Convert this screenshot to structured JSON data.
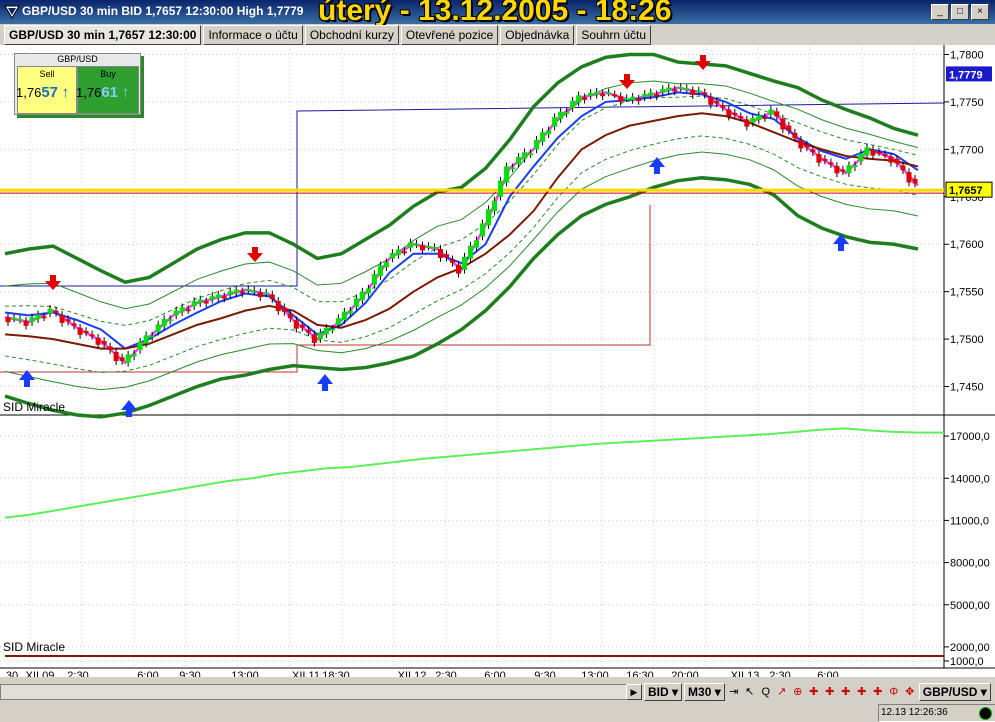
{
  "window": {
    "title": "GBP/USD 30 min BID 1,7657 12:30:00 High 1,7779",
    "date_overlay": "úterý - 13.12.2005 - 18:26",
    "minimize": "_",
    "restore": "□",
    "close": "×"
  },
  "tabs": [
    {
      "label": "GBP/USD 30 min 1,7657 12:30:00",
      "active": true
    },
    {
      "label": "Informace o účtu"
    },
    {
      "label": "Obchodní kurzy"
    },
    {
      "label": "Otevřené pozice"
    },
    {
      "label": "Objednávka"
    },
    {
      "label": "Souhrn účtu"
    }
  ],
  "quote_widget": {
    "symbol": "GBP/USD",
    "sell": {
      "label": "Sell",
      "price_prefix": "1,76",
      "price_pips": "57",
      "arrow": "↑"
    },
    "buy": {
      "label": "Buy",
      "price_prefix": "1,76",
      "price_pips": "61",
      "arrow": "↑"
    }
  },
  "price_panel": {
    "indicator_label": "SID Miracle",
    "y_ticks": [
      "1,7800",
      "1,7750",
      "1,7700",
      "1,7650",
      "1,7600",
      "1,7550",
      "1,7500",
      "1,7450"
    ],
    "current_price": "1,7657",
    "high_price": "1,7779",
    "colors": {
      "bull": "#00e000",
      "bear": "#e00000",
      "upper_band": "#1e7e1e",
      "price_line": "#ffd700",
      "arrow_up": "#1a3cff",
      "arrow_down": "#e00000",
      "magenta": "#ff40ff",
      "blue_ma": "#1a3cff",
      "brown_ma": "#7a1a00"
    }
  },
  "volume_panel": {
    "indicator_label": "SID Miracle",
    "y_ticks": [
      "17000,0",
      "14000,0",
      "11000,0",
      "8000,00",
      "5000,00",
      "2000,00",
      "1000,0"
    ]
  },
  "x_axis": {
    "ticks": [
      "30",
      "XII.09",
      "2:30",
      "6:00",
      "9:30",
      "13:00",
      "XII.11",
      "18:30",
      "XII.12",
      "2:30",
      "6:00",
      "9:30",
      "13:00",
      "16:30",
      "20:00",
      "XII.13",
      "2:30",
      "6:00"
    ]
  },
  "chart_data": [
    {
      "type": "line",
      "title": "",
      "ylabel": "",
      "ylim": [
        1.742,
        1.781
      ],
      "series": [
        {
          "values": [
            1.7523,
            1.7518,
            1.753,
            1.7512,
            1.7498,
            1.7475,
            1.7502,
            1.7525,
            1.7538,
            1.7545,
            1.7552,
            1.7547,
            1.752,
            1.75,
            1.752,
            1.7548,
            1.7585,
            1.76,
            1.7595,
            1.7573,
            1.762,
            1.768,
            1.77,
            1.7732,
            1.7755,
            1.776,
            1.7752,
            1.7758,
            1.7765,
            1.776,
            1.7742,
            1.7728,
            1.774,
            1.771,
            1.769,
            1.7675,
            1.77,
            1.769,
            1.7662
          ]
        },
        {
          "values": [
            1.7528,
            1.7525,
            1.7528,
            1.752,
            1.751,
            1.749,
            1.75,
            1.7515,
            1.7528,
            1.754,
            1.7548,
            1.7545,
            1.7525,
            1.7505,
            1.7515,
            1.7538,
            1.757,
            1.759,
            1.759,
            1.758,
            1.76,
            1.765,
            1.7682,
            1.7712,
            1.7735,
            1.775,
            1.7752,
            1.7755,
            1.776,
            1.7758,
            1.775,
            1.7738,
            1.7732,
            1.7712,
            1.7698,
            1.769,
            1.77,
            1.7695,
            1.7678
          ]
        },
        {
          "values": [
            1.7505,
            1.7503,
            1.75,
            1.7495,
            1.749,
            1.749,
            1.7495,
            1.7505,
            1.7515,
            1.7522,
            1.753,
            1.7535,
            1.753,
            1.7515,
            1.7512,
            1.752,
            1.7532,
            1.755,
            1.7565,
            1.7575,
            1.759,
            1.761,
            1.7635,
            1.767,
            1.77,
            1.7715,
            1.7725,
            1.773,
            1.7735,
            1.7738,
            1.7735,
            1.7728,
            1.7718,
            1.7708,
            1.77,
            1.7693,
            1.769,
            1.7688,
            1.7682
          ]
        },
        {
          "values": [
            1.759,
            1.7595,
            1.7598,
            1.7585,
            1.7572,
            1.756,
            1.7565,
            1.758,
            1.7595,
            1.7605,
            1.7612,
            1.7612,
            1.76,
            1.7585,
            1.759,
            1.7605,
            1.762,
            1.764,
            1.7655,
            1.766,
            1.768,
            1.771,
            1.7745,
            1.777,
            1.7787,
            1.7797,
            1.78,
            1.78,
            1.7792,
            1.779,
            1.7788,
            1.778,
            1.7772,
            1.7765,
            1.7752,
            1.7742,
            1.7733,
            1.7722,
            1.7715
          ]
        },
        {
          "values": [
            1.744,
            1.7432,
            1.7425,
            1.742,
            1.7418,
            1.7422,
            1.743,
            1.744,
            1.745,
            1.7458,
            1.7462,
            1.7468,
            1.7472,
            1.747,
            1.7468,
            1.747,
            1.7475,
            1.7482,
            1.7495,
            1.751,
            1.753,
            1.7555,
            1.7585,
            1.761,
            1.763,
            1.7642,
            1.765,
            1.766,
            1.7667,
            1.767,
            1.7668,
            1.7663,
            1.7652,
            1.763,
            1.7617,
            1.7608,
            1.7602,
            1.76,
            1.7595
          ]
        }
      ]
    },
    {
      "type": "line",
      "title": "",
      "ylim": [
        500,
        18500
      ],
      "series": [
        {
          "values": [
            11200,
            11400,
            11700,
            12000,
            12300,
            12600,
            12900,
            13200,
            13500,
            13800,
            14000,
            14300,
            14500,
            14700,
            14800,
            15000,
            15200,
            15400,
            15550,
            15700,
            15850,
            16000,
            16150,
            16300,
            16450,
            16550,
            16650,
            16750,
            16850,
            16950,
            17050,
            17150,
            17300,
            17450,
            17550,
            17400,
            17300,
            17250,
            17250
          ]
        },
        {
          "values": [
            1350,
            1350,
            1350,
            1350,
            1350,
            1350,
            1350,
            1350,
            1350,
            1350,
            1350,
            1350,
            1350,
            1350,
            1350,
            1350,
            1350,
            1350,
            1350,
            1350,
            1350,
            1350,
            1350,
            1350,
            1350,
            1350,
            1350,
            1350,
            1350,
            1350,
            1350,
            1350,
            1350,
            1350,
            1350,
            1350,
            1350,
            1350,
            1350
          ]
        }
      ]
    }
  ],
  "toolbar": {
    "price_type": "BID",
    "timeframe": "M30",
    "symbol": "GBP/USD",
    "icons": [
      "arrow-icon",
      "cursor-icon",
      "zoom-icon",
      "line-icon",
      "zoom-in-icon",
      "tool-icon",
      "tool-icon",
      "tool-icon",
      "tool-icon",
      "tool-icon",
      "fibo-icon",
      "target-icon"
    ]
  },
  "status": {
    "time": "12.13 12:26:36"
  }
}
